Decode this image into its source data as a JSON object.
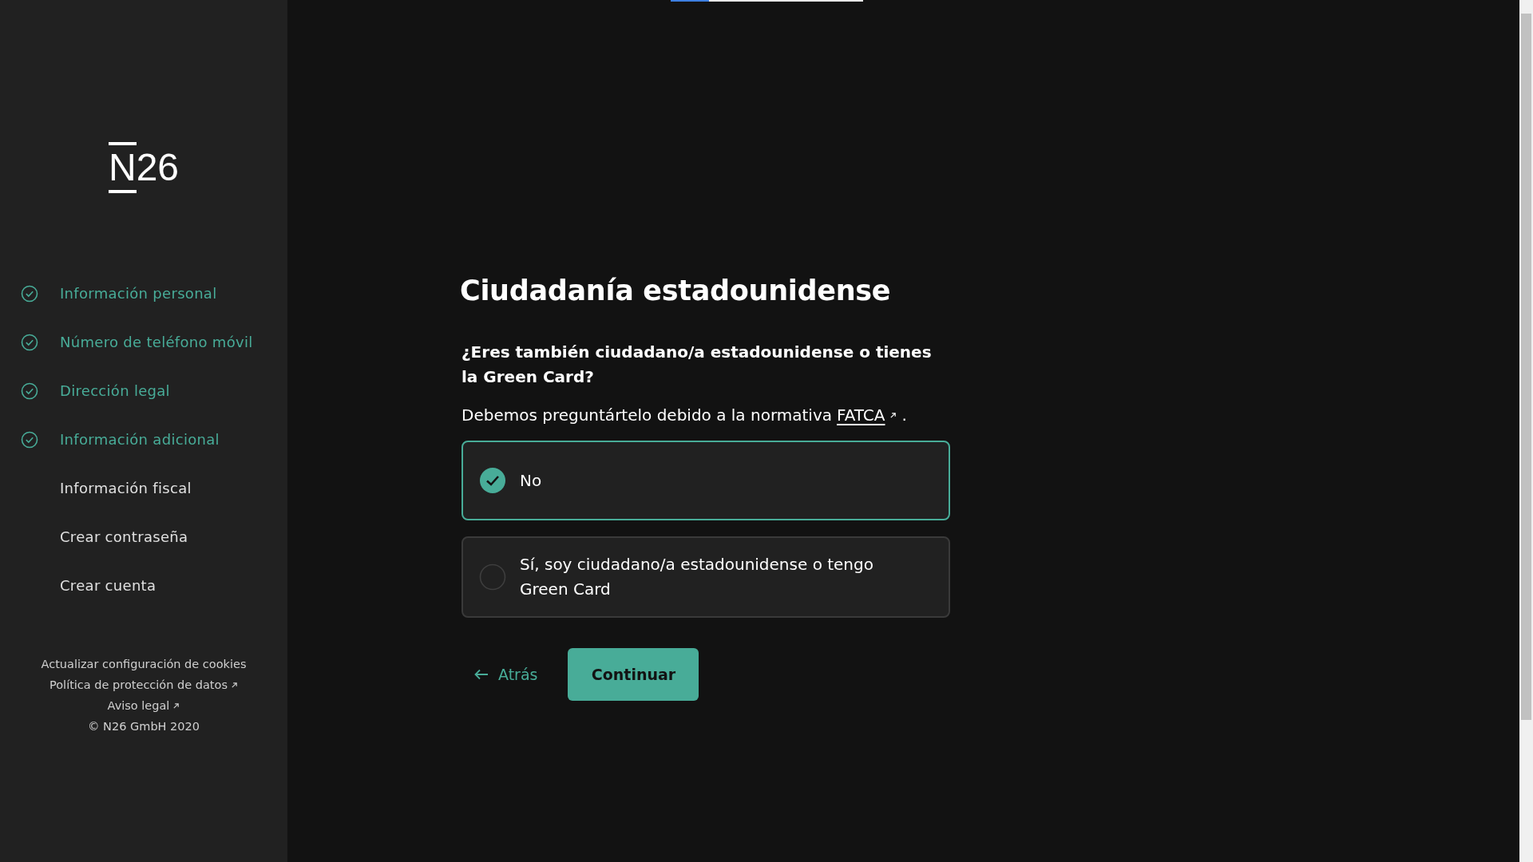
{
  "progress": {
    "level": 0.2
  },
  "sidebar": {
    "logo": "N26",
    "steps": [
      {
        "label": "Información personal",
        "done": true
      },
      {
        "label": "Número de teléfono móvil",
        "done": true
      },
      {
        "label": "Dirección legal",
        "done": true
      },
      {
        "label": "Información adicional",
        "done": true
      },
      {
        "label": "Información fiscal",
        "done": false
      },
      {
        "label": "Crear contraseña",
        "done": false
      },
      {
        "label": "Crear cuenta",
        "done": false
      }
    ],
    "footer_links": [
      {
        "label": "Actualizar configuración de cookies",
        "external": false
      },
      {
        "label": "Política de protección de datos",
        "external": true
      },
      {
        "label": "Aviso legal",
        "external": true
      }
    ],
    "copyright": "© N26 GmbH 2020"
  },
  "main": {
    "title": "Ciudadanía estadounidense",
    "question": "¿Eres también ciudadano/a estadounidense o tienes la Green Card?",
    "note": "Debemos preguntártelo debido a la normativa",
    "note_link": "FATCA",
    "note_end": ".",
    "options": [
      {
        "label": "No",
        "selected": true
      },
      {
        "label": "Sí, soy ciudadano/a estadounidense o tengo Green Card",
        "selected": false
      }
    ],
    "back": "Atrás",
    "continue": "Continuar"
  }
}
